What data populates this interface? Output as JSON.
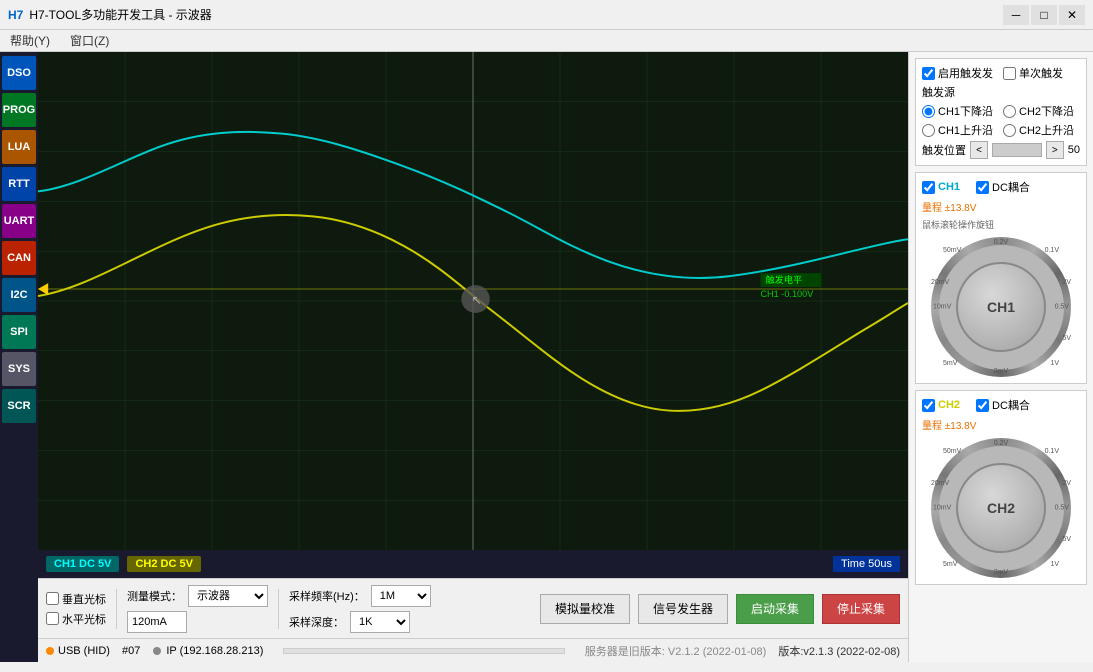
{
  "window": {
    "title": "H7-TOOL多功能开发工具 - 示波器",
    "icon": "H7"
  },
  "menu": {
    "items": [
      "帮助(Y)",
      "窗口(Z)"
    ]
  },
  "sidebar": {
    "buttons": [
      {
        "id": "dso",
        "label": "DSO",
        "color": "#0066cc"
      },
      {
        "id": "prog",
        "label": "PROG",
        "color": "#009933"
      },
      {
        "id": "lua",
        "label": "LUA",
        "color": "#cc6600"
      },
      {
        "id": "rtt",
        "label": "RTT",
        "color": "#0066cc"
      },
      {
        "id": "uart",
        "label": "UART",
        "color": "#990099"
      },
      {
        "id": "can",
        "label": "CAN",
        "color": "#cc3300"
      },
      {
        "id": "i2c",
        "label": "I2C",
        "color": "#006699"
      },
      {
        "id": "spi",
        "label": "SPI",
        "color": "#009966"
      },
      {
        "id": "sys",
        "label": "SYS",
        "color": "#666666"
      },
      {
        "id": "scr",
        "label": "SCR",
        "color": "#006666"
      }
    ]
  },
  "scope": {
    "ch1_label": "CH1  DC   5V",
    "ch2_label": "CH2  DC   5V",
    "time_label": "Time  50us",
    "trigger_label": "触发电平",
    "trigger_value": "CH1 -0.100V",
    "grid_color": "#1a3a1a"
  },
  "right_panel": {
    "trigger_section": {
      "enable_trigger": "启用触发发",
      "single_trigger": "单次触发",
      "trigger_source_label": "触发源",
      "ch1_fall": "CH1下降沿",
      "ch2_fall": "CH2下降沿",
      "ch1_rise": "CH1上升沿",
      "ch2_rise": "CH2上升沿",
      "trigger_pos_label": "触发位置",
      "trigger_pos_value": "50",
      "trigger_pos_btn_left": "<",
      "trigger_pos_btn_right": ">"
    },
    "ch1_section": {
      "label": "CH1",
      "dc_coupling": "DC耦合",
      "range": "量程 ±13.8V",
      "hint": "鼠标滚轮操作旋钮",
      "knob_label": "CH1",
      "knob_marks": [
        "2mV",
        "5mV",
        "10mV",
        "20mV",
        "50mV",
        "0.1V",
        "0.2V",
        "0.5V",
        "1V",
        "2V",
        "5V"
      ]
    },
    "ch2_section": {
      "label": "CH2",
      "dc_coupling": "DC耦合",
      "range": "量程 ±13.8V",
      "knob_label": "CH2",
      "knob_marks": [
        "2mV",
        "5mV",
        "10mV",
        "20mV",
        "50mV",
        "0.1V",
        "0.2V",
        "0.5V",
        "1V",
        "2V",
        "5V"
      ]
    }
  },
  "controls": {
    "vertical_marker": "垂直光标",
    "horizontal_marker": "水平光标",
    "measure_mode_label": "测量模式：",
    "measure_mode": "示波器",
    "current_value": "120mA",
    "sample_rate_label": "采样频率(Hz)：",
    "sample_rate": "1M",
    "sample_depth_label": "采样深度：",
    "sample_depth": "1K",
    "calibrate_btn": "模拟量校准",
    "signal_gen_btn": "信号发生器",
    "start_btn": "启动采集",
    "stop_btn": "停止采集"
  },
  "status": {
    "usb_label": "USB (HID)",
    "device_id": "#07",
    "ip_label": "IP (192.168.28.213)",
    "server_info": "服务器是旧版本: V2.1.2 (2022-01-08)",
    "version": "版本:v2.1.3 (2022-02-08)"
  }
}
